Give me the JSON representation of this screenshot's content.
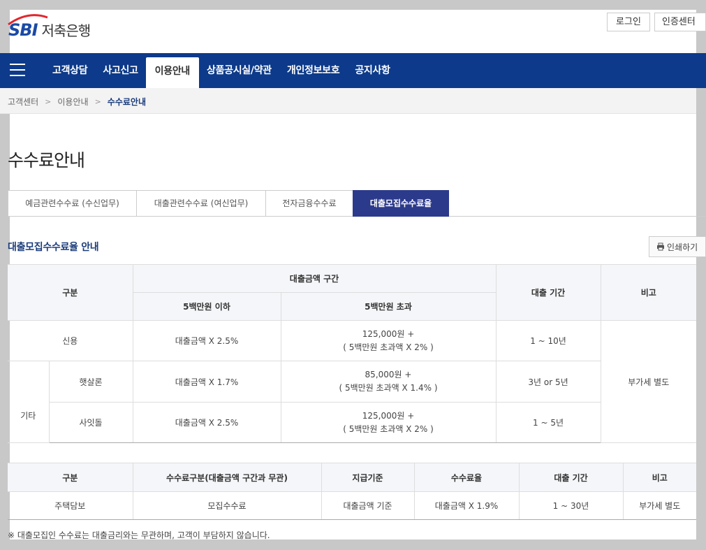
{
  "header": {
    "logo_brand": "SBI",
    "logo_text": "저축은행",
    "login_label": "로그인",
    "cert_label": "인증센터"
  },
  "gnb": {
    "items": [
      {
        "label": "고객상담"
      },
      {
        "label": "사고신고"
      },
      {
        "label": "이용안내"
      },
      {
        "label": "상품공시실/약관"
      },
      {
        "label": "개인정보보호"
      },
      {
        "label": "공지사항"
      }
    ]
  },
  "breadcrumb": {
    "items": [
      "고객센터",
      "이용안내",
      "수수료안내"
    ]
  },
  "page_title": "수수료안내",
  "tabs": [
    {
      "label": "예금관련수수료 (수신업무)"
    },
    {
      "label": "대출관련수수료 (여신업무)"
    },
    {
      "label": "전자금융수수료"
    },
    {
      "label": "대출모집수수료율"
    }
  ],
  "section_title": "대출모집수수료율 안내",
  "print_label": "인쇄하기",
  "table1": {
    "h_category": "구분",
    "h_amount_range": "대출금액 구간",
    "h_under": "5백만원 이하",
    "h_over": "5백만원 초과",
    "h_period": "대출 기간",
    "h_note": "비고",
    "rows": [
      {
        "group": "",
        "name": "신용",
        "under": "대출금액 X 2.5%",
        "over1": "125,000원 +",
        "over2": "( 5백만원 초과액 X 2% )",
        "period": "1 ~ 10년"
      },
      {
        "group": "기타",
        "name": "햇살론",
        "under": "대출금액 X 1.7%",
        "over1": "85,000원 +",
        "over2": "( 5백만원 초과액 X 1.4% )",
        "period": "3년 or 5년"
      },
      {
        "group": "",
        "name": "사잇돌",
        "under": "대출금액 X 2.5%",
        "over1": "125,000원 +",
        "over2": "( 5백만원 초과액 X 2% )",
        "period": "1 ~ 5년"
      }
    ],
    "note_value": "부가세 별도"
  },
  "table2": {
    "headers": [
      "구분",
      "수수료구분(대출금액 구간과 무관)",
      "지급기준",
      "수수료율",
      "대출 기간",
      "비고"
    ],
    "row": [
      "주택담보",
      "모집수수료",
      "대출금액 기준",
      "대출금액 X 1.9%",
      "1 ~ 30년",
      "부가세 별도"
    ]
  },
  "footnote": "※ 대출모집인 수수료는 대출금리와는 무관하며, 고객이 부담하지 않습니다.",
  "colors": {
    "brand": "#1b4aa5",
    "gnb_bg": "#0d3a8a",
    "tab_active": "#2c3a8c",
    "logo_accent": "#e4252d"
  }
}
